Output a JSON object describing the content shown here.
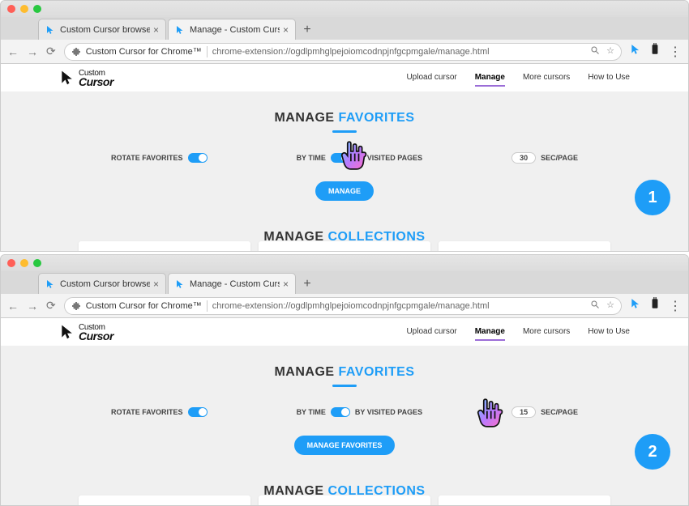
{
  "windows": [
    {
      "step_number": "1",
      "tabs": {
        "tab1": "Custom Cursor browser extensi",
        "tab2": "Manage - Custom Cursor for Ch"
      },
      "omnibox": {
        "site": "Custom Cursor for Chrome™",
        "url": "chrome-extension://ogdlpmhglpejoiomcodnpjnfgcpmgale/manage.html"
      },
      "nav": {
        "upload": "Upload cursor",
        "manage": "Manage",
        "more": "More cursors",
        "howto": "How to Use"
      },
      "logo": {
        "line1": "Custom",
        "line2": "Cursor"
      },
      "heading_favorites": {
        "pre": "MANAGE ",
        "accent": "FAVORITES"
      },
      "controls": {
        "rotate": "ROTATE FAVORITES",
        "bytime": "BY TIME",
        "byvisited": "BY VISITED PAGES",
        "secpage": "SEC/PAGE",
        "secval": "30"
      },
      "button_manage": "MANAGE",
      "heading_collections": {
        "pre": "MANAGE ",
        "accent": "COLLECTIONS"
      }
    },
    {
      "step_number": "2",
      "tabs": {
        "tab1": "Custom Cursor browser extensi",
        "tab2": "Manage - Custom Cursor for Ch"
      },
      "omnibox": {
        "site": "Custom Cursor for Chrome™",
        "url": "chrome-extension://ogdlpmhglpejoiomcodnpjnfgcpmgale/manage.html"
      },
      "nav": {
        "upload": "Upload cursor",
        "manage": "Manage",
        "more": "More cursors",
        "howto": "How to Use"
      },
      "logo": {
        "line1": "Custom",
        "line2": "Cursor"
      },
      "heading_favorites": {
        "pre": "MANAGE ",
        "accent": "FAVORITES"
      },
      "controls": {
        "rotate": "ROTATE FAVORITES",
        "bytime": "BY TIME",
        "byvisited": "BY VISITED PAGES",
        "secpage": "SEC/PAGE",
        "secval": "15"
      },
      "button_manage": "MANAGE FAVORITES",
      "heading_collections": {
        "pre": "MANAGE ",
        "accent": "COLLECTIONS"
      }
    }
  ]
}
